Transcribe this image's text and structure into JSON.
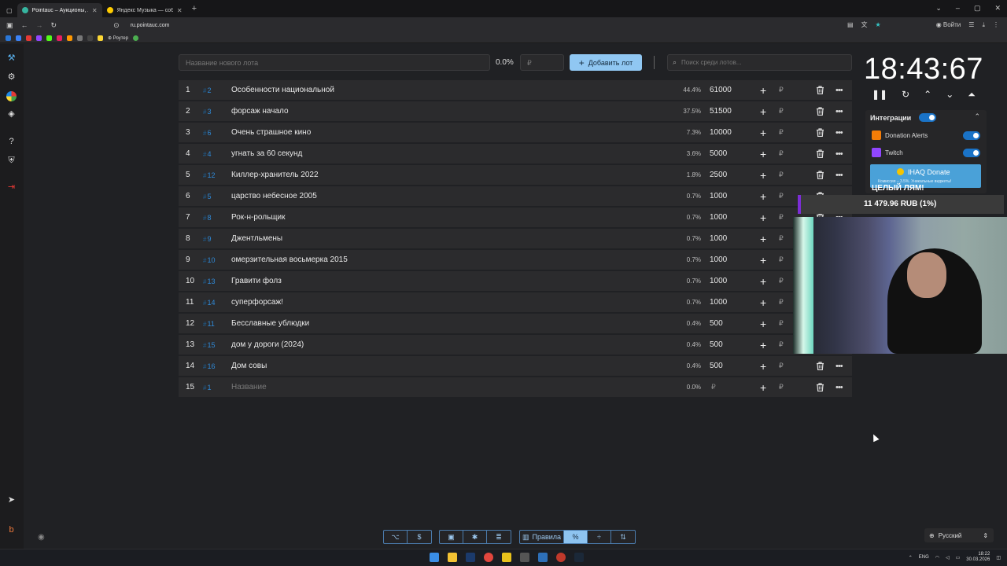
{
  "browser": {
    "tabs": [
      {
        "title": "Pointauc – Аукционы, лотереи",
        "active": true
      },
      {
        "title": "Яндекс Музыка — собирае",
        "active": false
      }
    ],
    "url": "ru.pointauc.com",
    "bookmark_router": "Роутер",
    "login": "Войти"
  },
  "toolbar": {
    "new_lot_placeholder": "Название нового лота",
    "percent": "0.0%",
    "price_placeholder": "₽",
    "add_lot_label": "Добавить лот",
    "search_placeholder": "Поиск среди лотов..."
  },
  "lots": [
    {
      "num": "1",
      "id": "2",
      "name": "Особенности национальной",
      "pct": "44.4%",
      "amount": "61000"
    },
    {
      "num": "2",
      "id": "3",
      "name": "форсаж начало",
      "pct": "37.5%",
      "amount": "51500"
    },
    {
      "num": "3",
      "id": "6",
      "name": "Очень страшное кино",
      "pct": "7.3%",
      "amount": "10000"
    },
    {
      "num": "4",
      "id": "4",
      "name": "угнать за 60 секунд",
      "pct": "3.6%",
      "amount": "5000"
    },
    {
      "num": "5",
      "id": "12",
      "name": "Киллер-хранитель 2022",
      "pct": "1.8%",
      "amount": "2500"
    },
    {
      "num": "6",
      "id": "5",
      "name": "царство небесное 2005",
      "pct": "0.7%",
      "amount": "1000"
    },
    {
      "num": "7",
      "id": "8",
      "name": "Рок-н-рольщик",
      "pct": "0.7%",
      "amount": "1000"
    },
    {
      "num": "8",
      "id": "9",
      "name": "Джентльмены",
      "pct": "0.7%",
      "amount": "1000"
    },
    {
      "num": "9",
      "id": "10",
      "name": "омерзительная восьмерка 2015",
      "pct": "0.7%",
      "amount": "1000"
    },
    {
      "num": "10",
      "id": "13",
      "name": "Гравити фолз",
      "pct": "0.7%",
      "amount": "1000"
    },
    {
      "num": "11",
      "id": "14",
      "name": "суперфорсаж!",
      "pct": "0.7%",
      "amount": "1000"
    },
    {
      "num": "12",
      "id": "11",
      "name": "Бесславные ублюдки",
      "pct": "0.4%",
      "amount": "500"
    },
    {
      "num": "13",
      "id": "15",
      "name": "дом у дороги (2024)",
      "pct": "0.4%",
      "amount": "500"
    },
    {
      "num": "14",
      "id": "16",
      "name": "Дом совы",
      "pct": "0.4%",
      "amount": "500"
    },
    {
      "num": "15",
      "id": "1",
      "name": "Название",
      "pct": "0.0%",
      "amount": "₽",
      "placeholder": true
    }
  ],
  "currency": "₽",
  "timer": {
    "value": "18:43:67"
  },
  "integrations": {
    "title": "Интеграции",
    "items": [
      {
        "label": "Donation Alerts",
        "enabled": true,
        "color": "#f57d07"
      },
      {
        "label": "Twitch",
        "enabled": true,
        "color": "#9146ff"
      }
    ],
    "ihaq_title": "IHAQ Donate",
    "ihaq_subtitle": "Комиссия – 3.5%. Уникальные виджеты!"
  },
  "overlay": {
    "goal_title": "ЦЕЛЫЙ ЛЯМ!",
    "goal_amount": "11 479.96 RUB (1%)"
  },
  "bottom": {
    "rules_label": "Правила",
    "language": "Русский"
  },
  "taskbar": {
    "lang": "ENG",
    "time": "18:22",
    "date": "30.03.2026"
  },
  "colors": {
    "accent": "#90c7f2",
    "lot_id": "#2f8ad8",
    "background": "#202124",
    "row": "#2b2b2d"
  }
}
